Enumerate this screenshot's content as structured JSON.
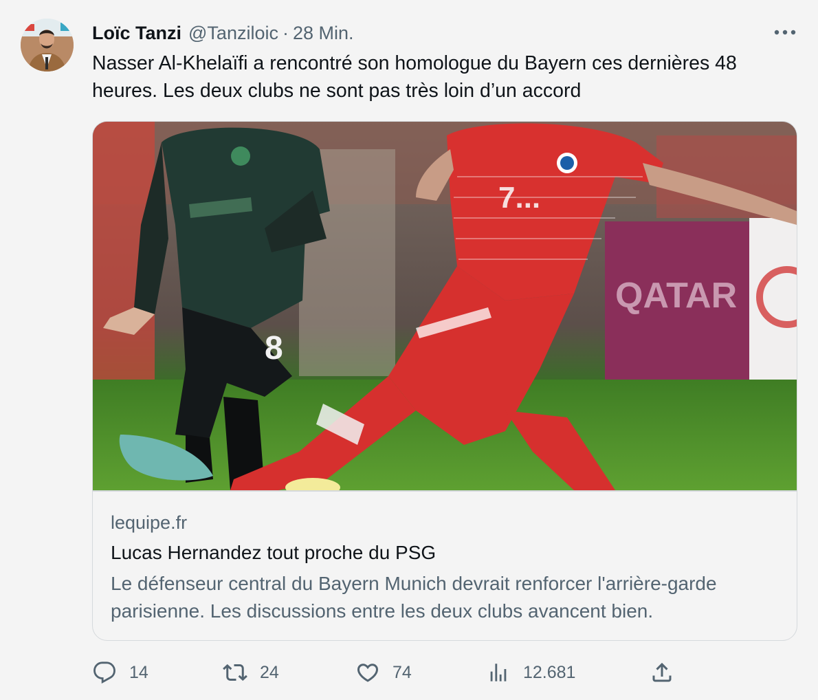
{
  "tweet": {
    "author_name": "Loïc Tanzi",
    "author_handle": "@Tanziloic",
    "separator": "·",
    "time": "28 Min.",
    "text": "Nasser Al-Khelaïfi a rencontré son homologue du Bayern ces dernières 48 heures. Les deux clubs ne sont pas très loin d’un accord"
  },
  "card": {
    "domain": "lequipe.fr",
    "title": "Lucas Hernandez tout proche du PSG",
    "description": "Le défenseur central du Bayern Munich devrait renforcer l'arrière-garde parisienne. Les discussions entre les deux clubs avancent bien."
  },
  "actions": {
    "reply_count": "14",
    "retweet_count": "24",
    "like_count": "74",
    "views_count": "12.681"
  },
  "icons": {
    "more": "more-dots-icon",
    "reply": "reply-icon",
    "retweet": "retweet-icon",
    "like": "heart-icon",
    "views": "views-chart-icon",
    "share": "share-icon"
  },
  "colors": {
    "text": "#0f1419",
    "secondary": "#536471",
    "background": "#f4f4f4",
    "border": "#d5d9dc"
  }
}
